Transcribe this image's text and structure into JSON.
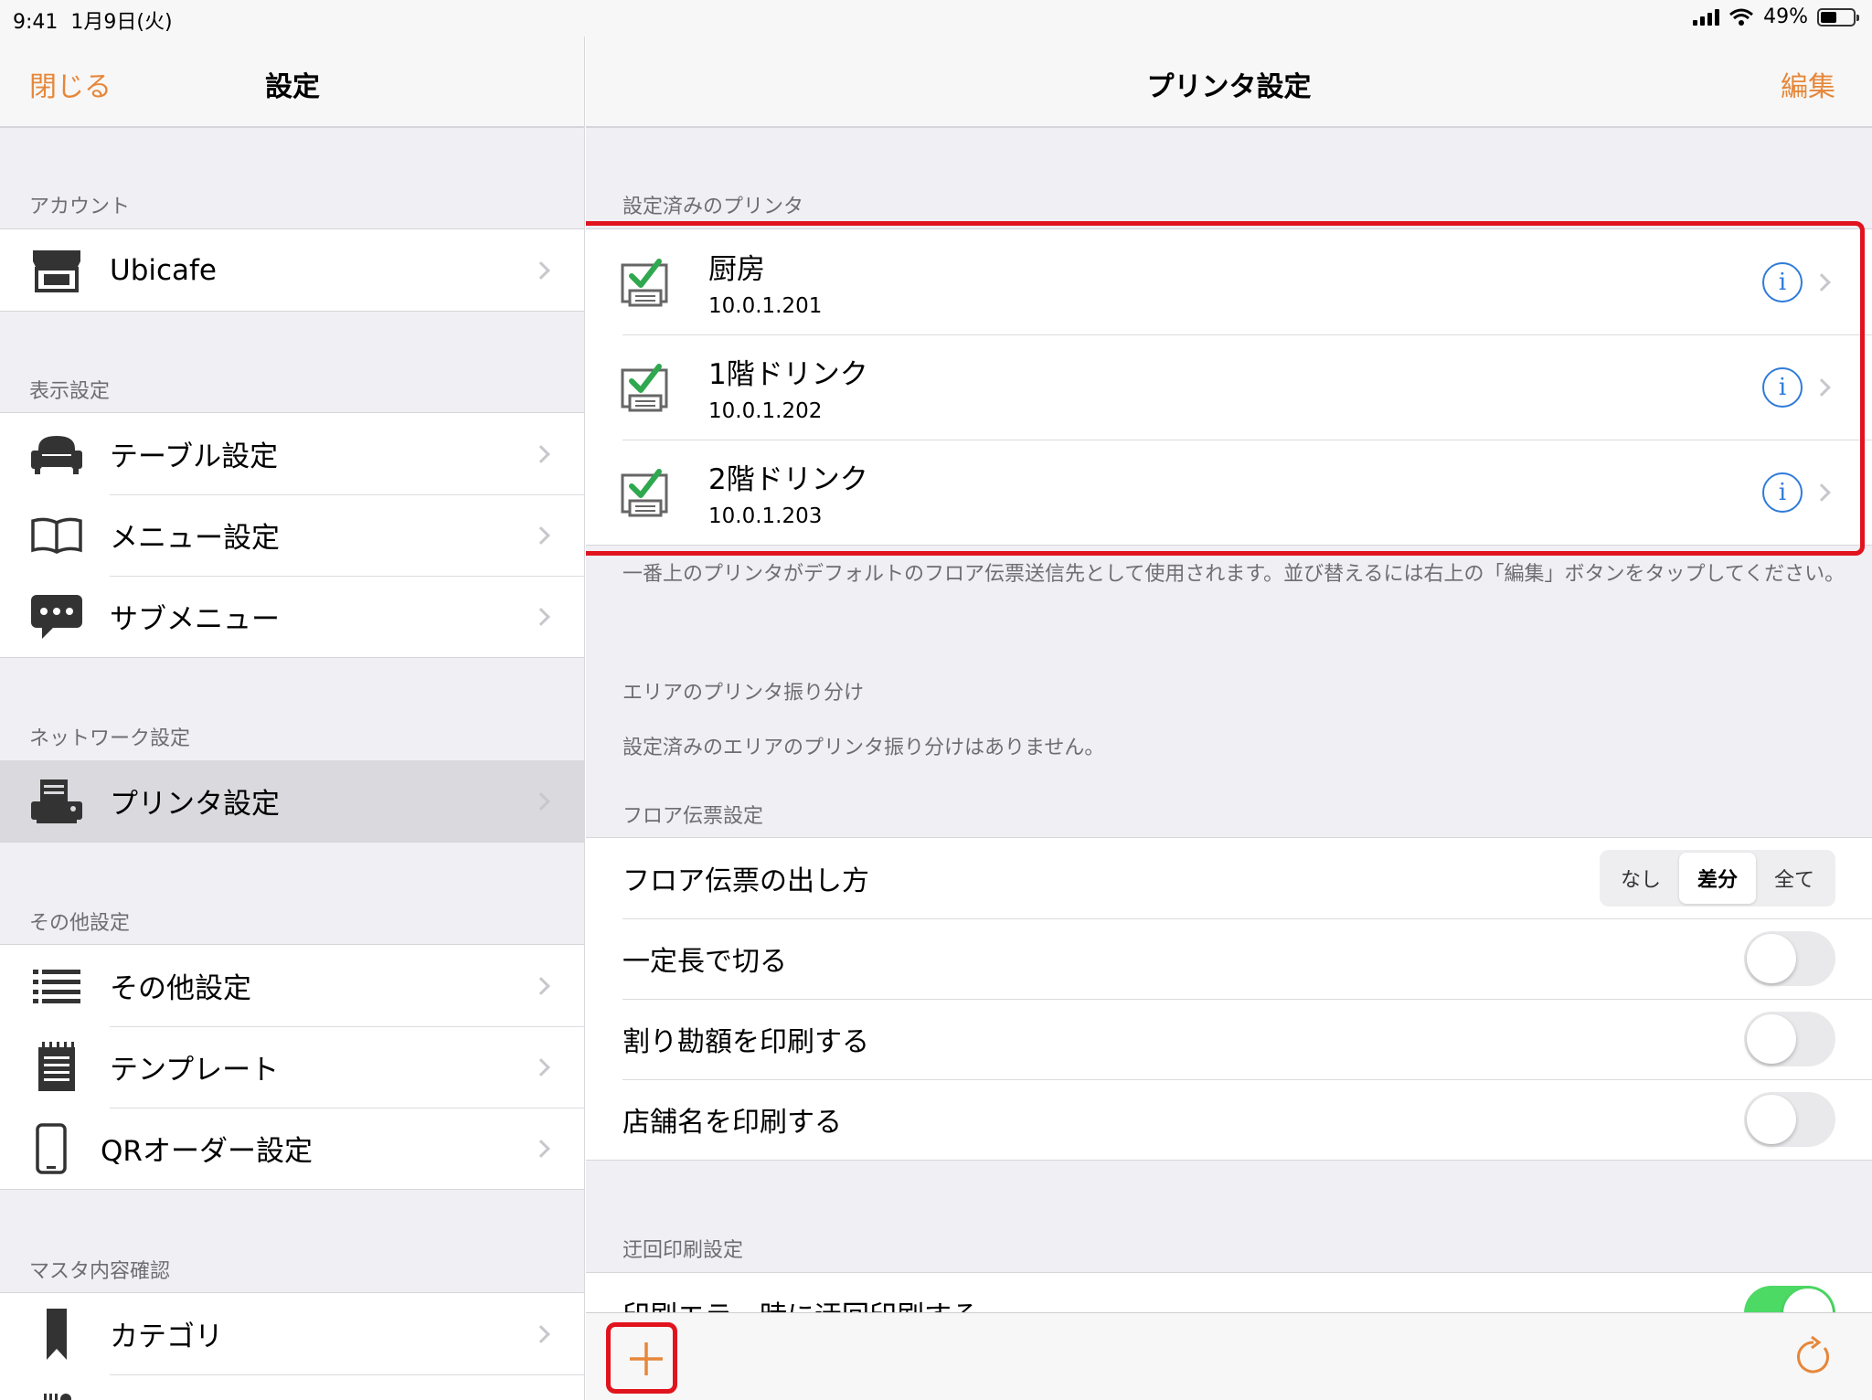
{
  "status_bar": {
    "time": "9:41",
    "date": "1月9日(火)",
    "battery": "49%"
  },
  "left": {
    "close_label": "閉じる",
    "title": "設定",
    "sections": [
      {
        "header": "アカウント",
        "items": [
          {
            "label": "Ubicafe",
            "icon": "store-icon"
          }
        ]
      },
      {
        "header": "表示設定",
        "items": [
          {
            "label": "テーブル設定",
            "icon": "sofa-icon"
          },
          {
            "label": "メニュー設定",
            "icon": "book-icon"
          },
          {
            "label": "サブメニュー",
            "icon": "speech-bubble-icon"
          }
        ]
      },
      {
        "header": "ネットワーク設定",
        "items": [
          {
            "label": "プリンタ設定",
            "icon": "printer-icon",
            "selected": true
          }
        ]
      },
      {
        "header": "その他設定",
        "items": [
          {
            "label": "その他設定",
            "icon": "list-icon"
          },
          {
            "label": "テンプレート",
            "icon": "notepad-icon"
          },
          {
            "label": "QRオーダー設定",
            "icon": "phone-icon"
          }
        ]
      },
      {
        "header": "マスタ内容確認",
        "items": [
          {
            "label": "カテゴリ",
            "icon": "bookmark-icon"
          }
        ]
      }
    ]
  },
  "right": {
    "title": "プリンタ設定",
    "edit_label": "編集",
    "printers_header": "設定済みのプリンタ",
    "printers": [
      {
        "name": "厨房",
        "ip": "10.0.1.201"
      },
      {
        "name": "1階ドリンク",
        "ip": "10.0.1.202"
      },
      {
        "name": "2階ドリンク",
        "ip": "10.0.1.203"
      }
    ],
    "printers_footer": "一番上のプリンタがデフォルトのフロア伝票送信先として使用されます。並び替えるには右上の「編集」ボタンをタップしてください。",
    "area_header": "エリアのプリンタ振り分け",
    "area_note": "設定済みのエリアのプリンタ振り分けはありません。",
    "floor_header": "フロア伝票設定",
    "floor_mode_label": "フロア伝票の出し方",
    "floor_mode_options": [
      "なし",
      "差分",
      "全て"
    ],
    "floor_mode_selected": "差分",
    "toggles": [
      {
        "label": "一定長で切る",
        "on": false
      },
      {
        "label": "割り勘額を印刷する",
        "on": false
      },
      {
        "label": "店舗名を印刷する",
        "on": false
      }
    ],
    "bypass_header": "迂回印刷設定",
    "bypass_label": "印刷エラー時に迂回印刷する",
    "bypass_on": true
  },
  "colors": {
    "accent": "#e6873a",
    "info_blue": "#2f7bd9",
    "highlight_red": "#e1141e",
    "check_green": "#2fa84f"
  }
}
